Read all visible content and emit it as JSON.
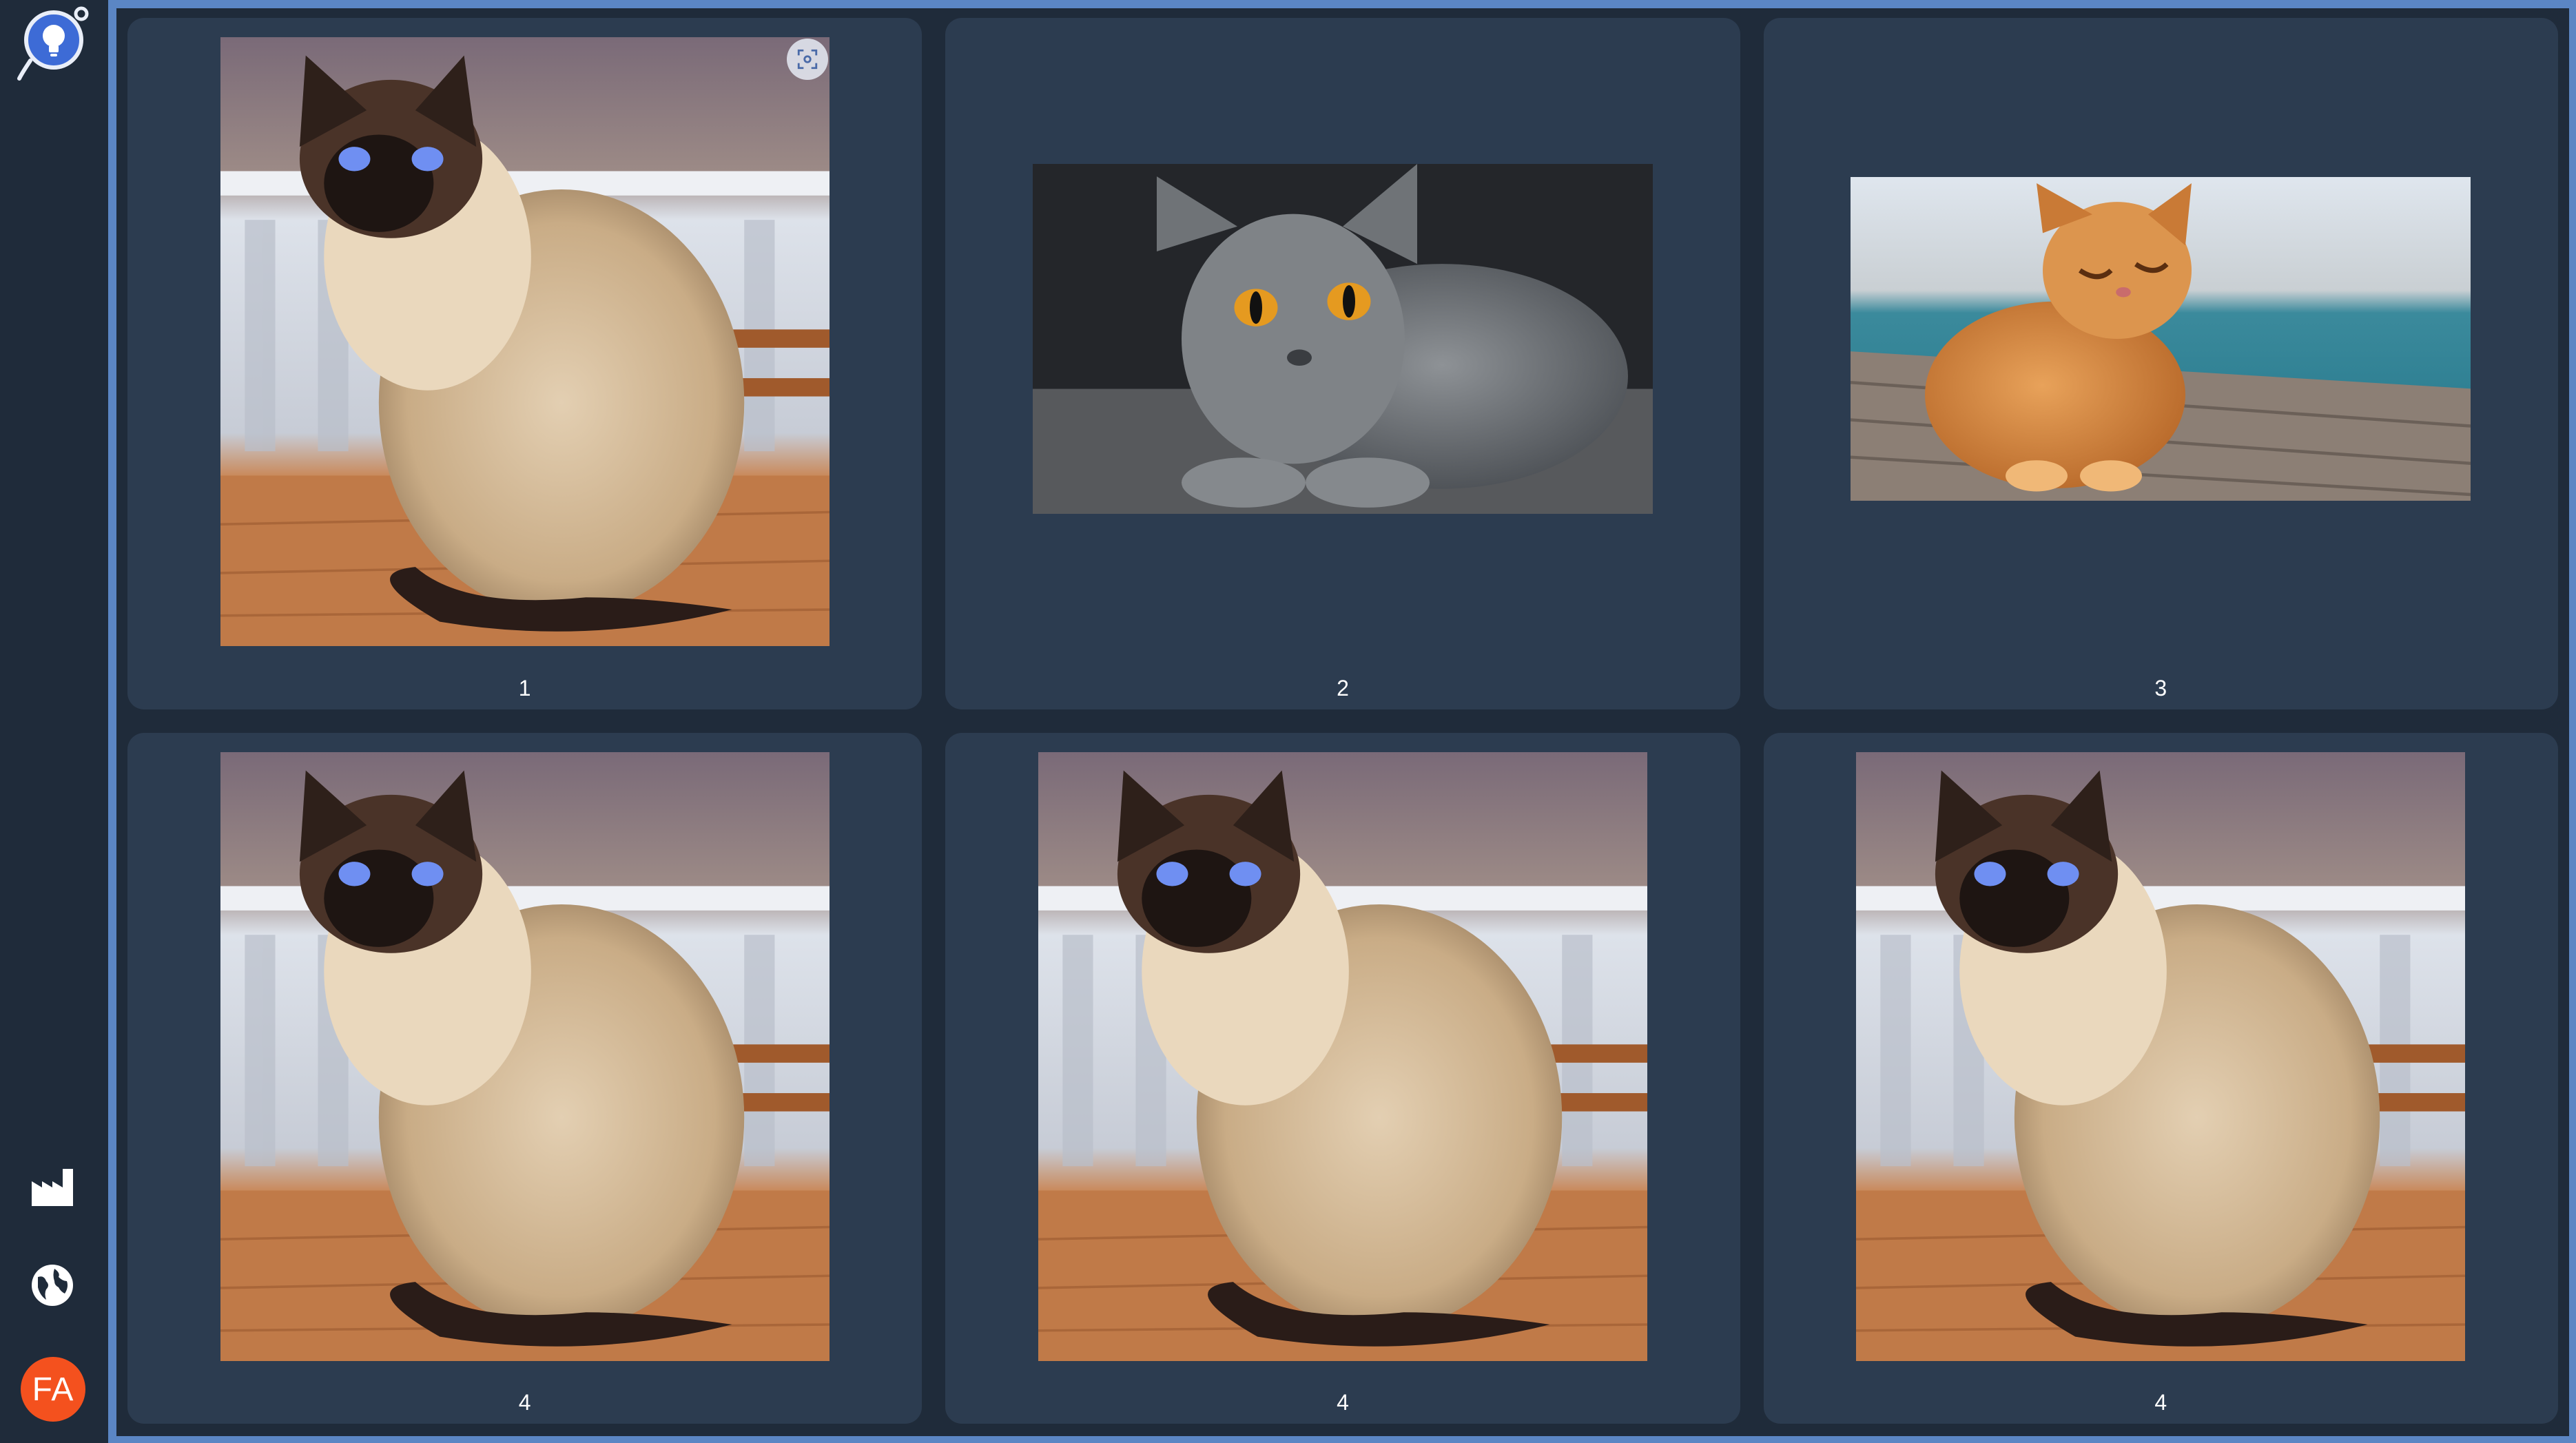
{
  "sidebar": {
    "logo_icon": "lightbulb-logo-icon",
    "nav_items": [
      {
        "icon": "factory-icon"
      },
      {
        "icon": "globe-icon"
      }
    ],
    "avatar_initials": "FA",
    "avatar_color": "#f4511e"
  },
  "gallery": {
    "items": [
      {
        "label": "1",
        "image": "siamese-cat"
      },
      {
        "label": "2",
        "image": "grey-british-shorthair-cat"
      },
      {
        "label": "3",
        "image": "orange-tabby-cat"
      },
      {
        "label": "4",
        "image": "siamese-cat"
      },
      {
        "label": "4",
        "image": "siamese-cat"
      },
      {
        "label": "4",
        "image": "siamese-cat"
      }
    ]
  },
  "colors": {
    "background": "#1f2b3a",
    "card": "#2c3c50",
    "frame_border": "#5b86c4"
  }
}
